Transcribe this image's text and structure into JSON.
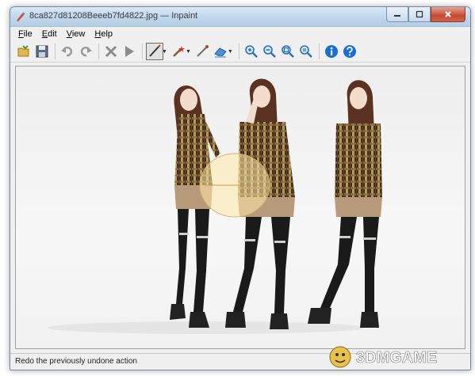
{
  "window": {
    "title": "8ca827d81208Beeeb7fd4822.jpg — Inpaint"
  },
  "menu": {
    "items": [
      {
        "key": "F",
        "rest": "ile"
      },
      {
        "key": "E",
        "rest": "dit"
      },
      {
        "key": "V",
        "rest": "iew"
      },
      {
        "key": "H",
        "rest": "elp"
      }
    ]
  },
  "toolbar": {
    "icons": [
      "open-icon",
      "save-icon",
      "undo-icon",
      "redo-icon",
      "delete-icon",
      "run-icon",
      "selection-tool-icon",
      "magic-wand-icon",
      "line-tool-icon",
      "eraser-icon",
      "zoom-fit-icon",
      "zoom-in-icon",
      "zoom-out-icon",
      "zoom-actual-icon",
      "info-icon",
      "help-icon"
    ]
  },
  "statusbar": {
    "text": "Redo the previously undone action"
  },
  "watermark": {
    "text": "3DMGAME"
  },
  "colors": {
    "title_gradient_top": "#d9e9f7",
    "close_button": "#c54a32",
    "info_blue": "#1a6fd1",
    "selection_fill": "#ffe9a8"
  }
}
